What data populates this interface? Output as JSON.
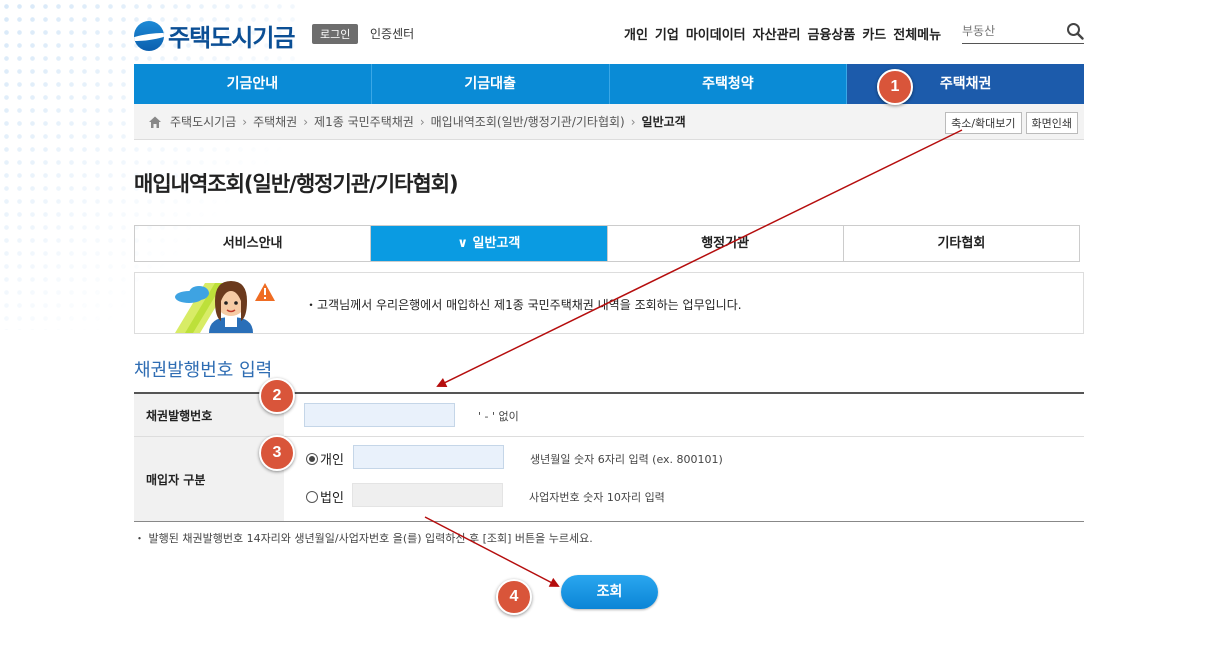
{
  "header": {
    "logo_text": "주택도시기금",
    "login_label": "로그인",
    "cert_center": "인증센터",
    "nav_items": [
      "개인",
      "기업",
      "마이데이터",
      "자산관리",
      "금융상품",
      "카드",
      "전체메뉴"
    ],
    "search_placeholder": "부동산"
  },
  "main_nav": [
    "기금안내",
    "기금대출",
    "주택청약",
    "주택채권"
  ],
  "breadcrumb": {
    "items": [
      "주택도시기금",
      "주택채권",
      "제1종 국민주택채권",
      "매입내역조회(일반/행정기관/기타협회)"
    ],
    "current": "일반고객",
    "zoom_button": "축소/확대보기",
    "print_button": "화면인쇄"
  },
  "page_title": "매입내역조회(일반/행정기관/기타협회)",
  "sub_tabs": [
    "서비스안내",
    "일반고객",
    "행정기관",
    "기타협회"
  ],
  "info_text": "・고객님께서 우리은행에서 매입하신 제1종 국민주택채권 내역을 조회하는 업무입니다.",
  "section_title": "채권발행번호 입력",
  "form": {
    "bond_label": "채권발행번호",
    "bond_hint": "' - ' 없이",
    "buyer_label": "매입자 구분",
    "individual_label": "개인",
    "individual_hint": "생년월일 숫자 6자리 입력 (ex. 800101)",
    "corporate_label": "법인",
    "corporate_hint": "사업자번호 숫자 10자리 입력"
  },
  "note": "・ 발행된 채권발행번호 14자리와 생년월일/사업자번호 을(를) 입력하신 후 [조회] 버튼을 누르세요.",
  "submit_label": "조회",
  "badges": [
    "1",
    "2",
    "3",
    "4"
  ],
  "colors": {
    "nav_blue": "#0a8bd6",
    "nav_active": "#1c5bab",
    "tab_active": "#0a9be2",
    "badge": "#d9553a",
    "arrow": "#b50d0d"
  }
}
